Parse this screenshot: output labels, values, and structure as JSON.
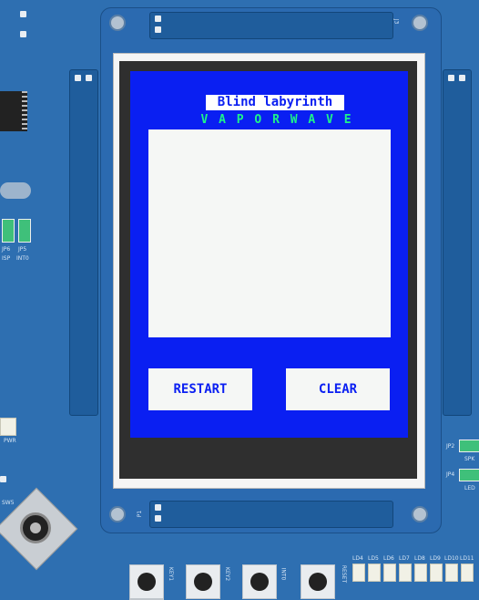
{
  "app": {
    "title": "Blind labyrinth",
    "subtitle": "V A P O R W A V E"
  },
  "buttons": {
    "restart": "RESTART",
    "clear": "CLEAR"
  },
  "board": {
    "jumper_labels": [
      "JP6",
      "JP5"
    ],
    "jumper_sublabels": [
      "ISP",
      "INT0"
    ],
    "key_labels": [
      "KEY1",
      "KEY2",
      "INT0",
      "RESET"
    ],
    "led_labels": [
      "LD4",
      "LD5",
      "LD6",
      "LD7",
      "LD8",
      "LD9",
      "LD10",
      "LD11"
    ],
    "right_labels": [
      "JP2",
      "SPK",
      "JP4",
      "LED"
    ],
    "misc": {
      "sw5": "SW5",
      "pwr": "PWR",
      "j3": "J3",
      "p1": "P1"
    }
  },
  "colors": {
    "pcb": "#2e6fb1",
    "screen_bg": "#0a1ff2",
    "subtitle": "#1ef28a",
    "canvas": "#f5f7f5"
  }
}
